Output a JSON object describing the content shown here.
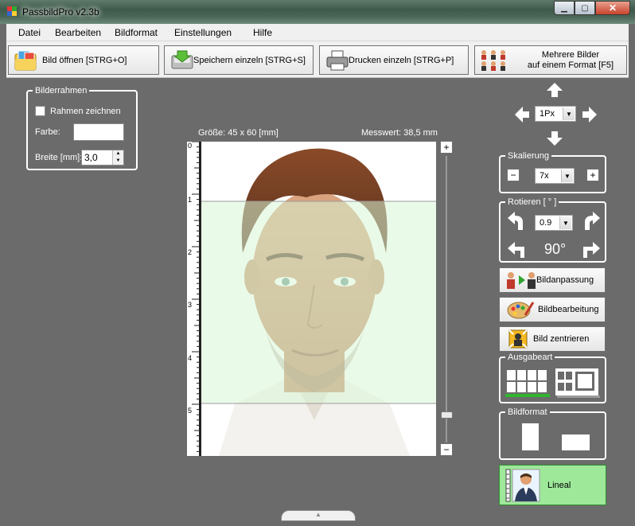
{
  "window": {
    "title": "PassbildPro  v2.3b"
  },
  "menu": [
    "Datei",
    "Bearbeiten",
    "Bildformat",
    "Einstellungen",
    "Hilfe"
  ],
  "toolbar": {
    "open": "Bild öffnen [STRG+O]",
    "save": "Speichern einzeln [STRG+S]",
    "print": "Drucken einzeln [STRG+P]",
    "multi_line1": "Mehrere Bilder",
    "multi_line2": "auf einem Format [F5]"
  },
  "frame_group": {
    "legend": "Bilderrahmen",
    "draw_label": "Rahmen zeichnen",
    "draw_checked": false,
    "color_label": "Farbe:",
    "color_value": "#ffffff",
    "width_label": "Breite [mm]:",
    "width_value": "3,0"
  },
  "photo": {
    "size_label": "Größe: 45 x 60 [mm]",
    "measure_label": "Messwert: 38,5 mm",
    "ruler_ticks": [
      "0",
      "1",
      "2",
      "3",
      "4",
      "5"
    ],
    "zoom_plus": "+",
    "zoom_minus": "−"
  },
  "move": {
    "step": "1Px"
  },
  "scale": {
    "legend": "Skalierung",
    "value": "7x",
    "minus": "−",
    "plus": "+"
  },
  "rotate": {
    "legend": "Rotieren [ ° ]",
    "value": "0.9",
    "degree_label": "90°"
  },
  "buttons": {
    "adjust": "Bildanpassung",
    "edit": "Bildbearbeitung",
    "center": "Bild zentrieren",
    "ruler": "Lineal"
  },
  "output": {
    "legend": "Ausgabeart"
  },
  "format": {
    "legend": "Bildformat"
  },
  "colors": {
    "accent_green": "#2fb52f",
    "guide_green": "#d9f5d6",
    "ruler_button_bg": "#9ee89a"
  }
}
